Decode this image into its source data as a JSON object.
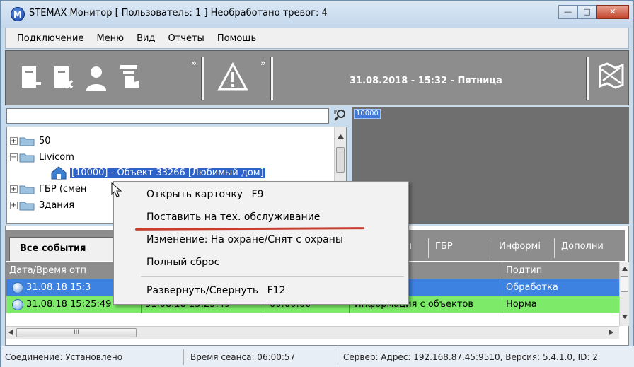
{
  "window": {
    "title": "STEMAX Монитор [ Пользователь: 1 ] Необработано тревог: 4",
    "icon_letter": "M",
    "buttons": {
      "minimize": "—",
      "maximize": "□",
      "close": "✕"
    }
  },
  "menu": [
    "Подключение",
    "Меню",
    "Вид",
    "Отчеты",
    "Помощь"
  ],
  "toolbar": {
    "icons": [
      "disconnect-icon",
      "remove-object-icon",
      "operator-icon",
      "hand-card-icon",
      "alarm-warning-icon",
      "map-icon"
    ],
    "more": "»",
    "datetime": "31.08.2018 - 15:32 - Пятница"
  },
  "search": {
    "value": ""
  },
  "map": {
    "tag": "10000"
  },
  "tree": [
    {
      "label": "50",
      "expander": "+"
    },
    {
      "label": "Livicom",
      "expander": "−"
    },
    {
      "label": "[10000] - Объект 33266 [Любимый дом]",
      "selected": true
    },
    {
      "label": "ГБР (смен",
      "expander": "+"
    },
    {
      "label": "Здания",
      "expander": "+"
    }
  ],
  "tabs": {
    "active": "Все события",
    "others": [
      "ГБР",
      "Информі",
      "Дополни"
    ],
    "partial": "ioı"
  },
  "grid": {
    "headers": {
      "datetime": "Дата/Время отп",
      "subtype": "Подтип"
    },
    "rows": [
      {
        "time1": "31.08.18 15:3",
        "time2": "",
        "dur": "",
        "type": "",
        "subtype": "Обработка",
        "color": "#3d82e0"
      },
      {
        "time1": "31.08.18 15:25:49",
        "time2": "31.08.18 15:25:49",
        "dur": "00:00:00",
        "type": "Информация с объектов",
        "subtype": "Норма",
        "color": "#7dea69"
      }
    ]
  },
  "context_menu": [
    {
      "label": "Открыть карточку",
      "shortcut": "F9"
    },
    {
      "label": "Поставить на тех. обслуживание",
      "shortcut": ""
    },
    {
      "label": "Изменение: На охране/Снят с охраны",
      "shortcut": ""
    },
    {
      "label": "Полный сброс",
      "shortcut": ""
    },
    {
      "label": "Развернуть/Свернуть",
      "shortcut": "F12"
    }
  ],
  "hscroll_grip": "III",
  "status": {
    "connection": "Соединение: Установлено",
    "session": "Время сеанса: 06:00:57",
    "server": "Сервер: Адрес: 192.168.87.45:9510, Версия: 5.4.1.0, ID: 2"
  }
}
